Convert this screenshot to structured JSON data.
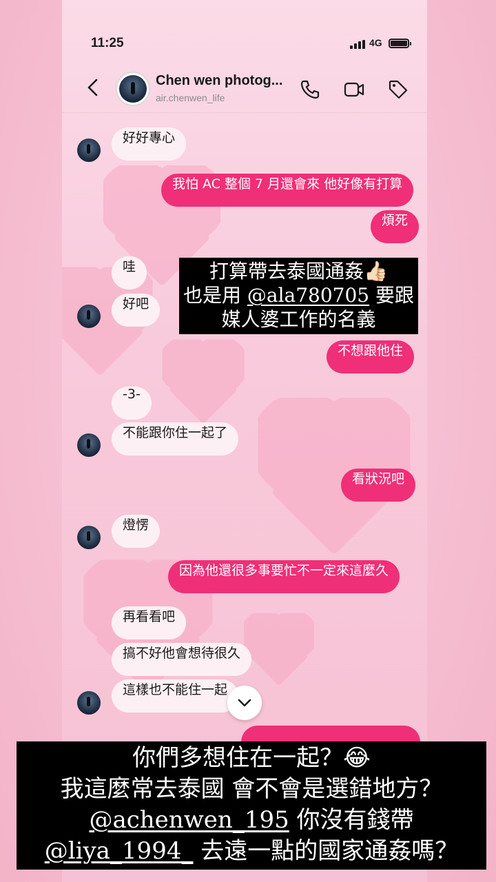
{
  "status": {
    "time": "11:25",
    "network": "4G"
  },
  "header": {
    "title": "Chen wen photog...",
    "subtitle": "air.chenwen_life"
  },
  "messages": {
    "m1": "好好專心",
    "m2": "我怕 AC 整個 7 月還會來 他好像有打算",
    "m3": "煩死",
    "m4": "哇",
    "m5": "好吧",
    "m6": "不想跟他住",
    "m7": "-3-",
    "m8": "不能跟你住一起了",
    "m9": "看狀況吧",
    "m10": "燈愣",
    "m11": "因為他還很多事要忙不一定來這麼久",
    "m12": "再看看吧",
    "m13": "搞不好他會想待很久",
    "m14": "這樣也不能住一起"
  },
  "overlay_top": {
    "line1": "打算帶去泰國通姦",
    "line1_emoji": "👍🏻",
    "line2_pre": "也是用 ",
    "line2_mention": "@ala780705",
    "line2_post": " 要跟",
    "line3": "媒人婆工作的名義"
  },
  "overlay_bottom": {
    "line1": "你們多想住在一起？",
    "line1_emoji": "😂",
    "line2": "我這麼常去泰國 會不會是選錯地方？",
    "line3_mention": "@achenwen_195",
    "line3_post": " 你沒有錢帶",
    "line4_mention": "@liya_1994_",
    "line4_post": " 去遠一點的國家通姦嗎？"
  },
  "icons": [
    "back-chevron-icon",
    "phone-call-icon",
    "video-call-icon",
    "tag-icon",
    "chevron-down-icon"
  ],
  "colors": {
    "outgoing_bubble": "#ef2f77",
    "incoming_bubble": "#fdf0f4",
    "background": "#f8cadb"
  }
}
